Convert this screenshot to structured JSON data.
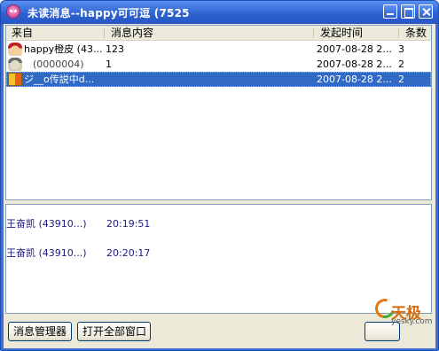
{
  "window": {
    "title": "未读消息--happy可可逗 (7525"
  },
  "list": {
    "columns": [
      "来自",
      "消息内容",
      "发起时间",
      "条数"
    ],
    "rows": [
      {
        "from": "happy橙皮 (43...",
        "content": "123",
        "time": "2007-08-28 2...",
        "count": "3",
        "avatar": "avatar-icon"
      },
      {
        "from": "(0000004)",
        "content": "1",
        "time": "2007-08-28 2...",
        "count": "2",
        "avatar": "avatar-icon"
      },
      {
        "from": "ジ__o传説中d...",
        "content": "",
        "time": "2007-08-28 2...",
        "count": "2",
        "avatar": "avatar-icon"
      }
    ]
  },
  "detail": {
    "entries": [
      {
        "sender": "王奋凯 (43910...)",
        "time": "20:19:51"
      },
      {
        "sender": "王奋凯 (43910...)",
        "time": "20:20:17"
      }
    ]
  },
  "buttons": {
    "manager": "消息管理器",
    "open_all": "打开全部窗口"
  },
  "watermark": {
    "brand": "天极",
    "url": "yesky.com"
  }
}
